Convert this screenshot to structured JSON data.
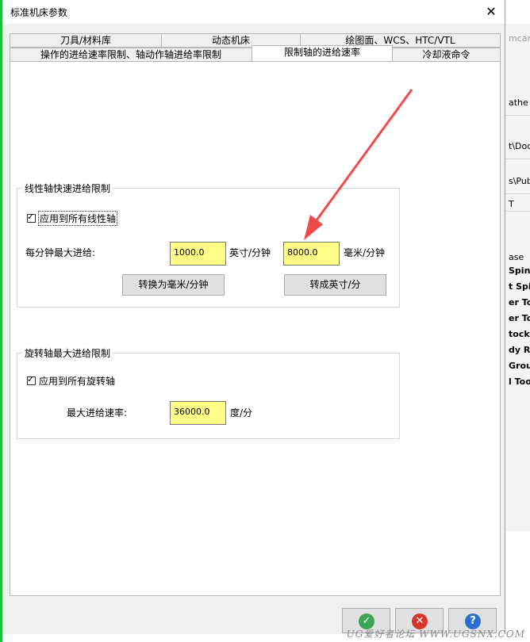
{
  "window": {
    "title": "标准机床参数"
  },
  "tabs": {
    "row1": [
      "刀具/材料库",
      "动态机床",
      "绘图面、WCS、HTC/VTL"
    ],
    "row2": [
      "操作的进给速率限制、轴动作轴进给率限制",
      "限制轴的进给速率",
      "冷却液命令"
    ]
  },
  "linear": {
    "group_title": "线性轴快速进给限制",
    "apply_all": "应用到所有线性轴",
    "max_feed_label": "每分钟最大进给:",
    "inch_value": "1000.0",
    "inch_unit": "英寸/分钟",
    "mm_value": "8000.0",
    "mm_unit": "毫米/分钟",
    "to_mm_button": "转换为毫米/分钟",
    "to_inch_button": "转成英寸/分"
  },
  "rotary": {
    "group_title": "旋转轴最大进给限制",
    "apply_all": "应用到所有旋转轴",
    "max_rate_label": "最大进给速率:",
    "value": "36000.0",
    "unit": "度/分"
  },
  "actions": {
    "ok_icon": "ok-check-icon",
    "cancel_icon": "cancel-x-icon",
    "help_icon": "help-question-icon",
    "colors": {
      "ok": "#3aa655",
      "cancel": "#d9362b",
      "help": "#2a6fd1",
      "highlight": "#ffff88",
      "arrow": "#f04a4a"
    }
  },
  "background_window": {
    "snippets": [
      "mcar",
      "athe D",
      "t\\Docu",
      "s\\Publ",
      "T",
      "ase",
      "Spind",
      "t Spin",
      "er Too",
      "er Too",
      "tock C",
      "dy Re",
      "Group",
      "l Tool"
    ]
  },
  "watermark": "UG爱好者论坛 WWW.UGSNX.COM"
}
